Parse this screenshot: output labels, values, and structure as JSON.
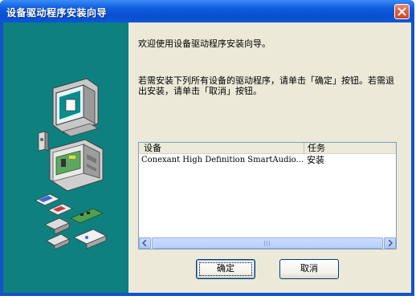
{
  "window": {
    "title": "设备驱动程序安装向导"
  },
  "content": {
    "welcome": "欢迎使用设备驱动程序安装向导。",
    "instructions": "若需安装下列所有设备的驱动程序，请单击「确定」按钮。若需退出安装，请单击「取消」按钮。"
  },
  "list": {
    "columns": [
      "设备",
      "任务"
    ],
    "rows": [
      {
        "device": "Conexant High Definition SmartAudio...",
        "task": "安装"
      }
    ]
  },
  "buttons": {
    "ok": "确定",
    "cancel": "取消"
  },
  "colors": {
    "titlebar": "#0a4fd0",
    "left_panel": "#0f8080",
    "dialog_bg": "#ece9d8",
    "close_button": "#e2583b"
  },
  "icons": {
    "close": "close-icon",
    "illustration": "computer-hardware-illustration",
    "scroll_left": "arrow-left-icon",
    "scroll_right": "arrow-right-icon"
  }
}
